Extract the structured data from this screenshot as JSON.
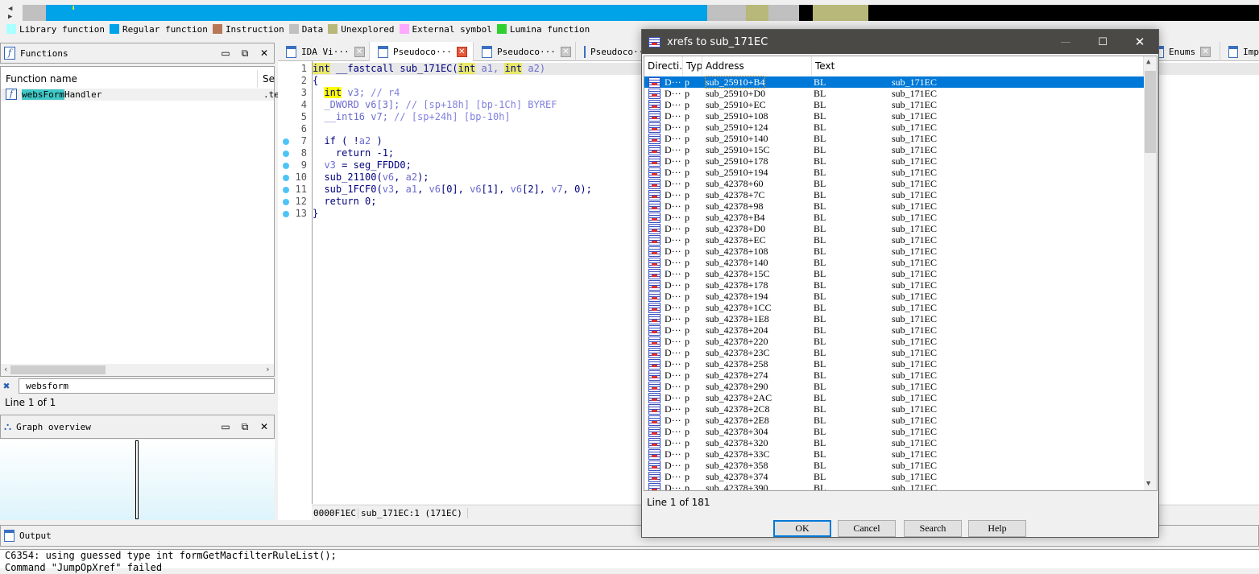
{
  "navbar": {
    "segments": [
      {
        "color": "#c0c0c0",
        "from": 0,
        "to": 1.9
      },
      {
        "color": "#00a2e8",
        "from": 1.9,
        "to": 55.4
      },
      {
        "color": "#c0c0c0",
        "from": 55.4,
        "to": 58.5
      },
      {
        "color": "#b8b87a",
        "from": 58.5,
        "to": 60.3
      },
      {
        "color": "#c0c0c0",
        "from": 60.3,
        "to": 62.8
      },
      {
        "color": "#000000",
        "from": 62.8,
        "to": 63.9
      },
      {
        "color": "#b8b87a",
        "from": 63.9,
        "to": 68.4
      },
      {
        "color": "#000000",
        "from": 68.4,
        "to": 100
      }
    ]
  },
  "legend": [
    {
      "label": "Library function",
      "color": "#aaffff"
    },
    {
      "label": "Regular function",
      "color": "#00a2e8"
    },
    {
      "label": "Instruction",
      "color": "#b87858"
    },
    {
      "label": "Data",
      "color": "#c0c0c0"
    },
    {
      "label": "Unexplored",
      "color": "#b8b87a"
    },
    {
      "label": "External symbol",
      "color": "#ffa8ff"
    },
    {
      "label": "Lumina function",
      "color": "#30d030"
    }
  ],
  "functions": {
    "title": "Functions",
    "col_name": "Function name",
    "col_seg": "Se",
    "rows": [
      {
        "name_match": "websForm",
        "name_rest": "Handler",
        "seg": ".te"
      }
    ],
    "filter": "websform",
    "status": "Line 1 of 1"
  },
  "graph_overview": {
    "title": "Graph overview"
  },
  "tabs": [
    {
      "label": "IDA Vi···"
    },
    {
      "label": "Pseudoco···",
      "active": true
    },
    {
      "label": "Pseudoco···"
    },
    {
      "label": "Pseudoco···"
    },
    {
      "label": "Enums"
    },
    {
      "label": "Imp"
    }
  ],
  "code": {
    "lines": [
      [
        [
          "int",
          "kwl"
        ],
        [
          " __fastcall sub_171EC(",
          "nm"
        ],
        [
          "int",
          "kwl"
        ],
        [
          " a1, ",
          "vr"
        ],
        [
          "int",
          "kwl"
        ],
        [
          " a2)",
          "vr"
        ]
      ],
      [
        [
          "{",
          "nm"
        ]
      ],
      [
        [
          "  ",
          ""
        ],
        [
          "int",
          "kw"
        ],
        [
          " v3; ",
          "vr"
        ],
        [
          "// r4",
          "cm"
        ]
      ],
      [
        [
          "  _DWORD v6[3]; ",
          "vr"
        ],
        [
          "// [sp+18h] [bp-1Ch] BYREF",
          "cm"
        ]
      ],
      [
        [
          "  __int16 v7; ",
          "vr"
        ],
        [
          "// [sp+24h] [bp-10h]",
          "cm"
        ]
      ],
      [
        [
          "",
          ""
        ]
      ],
      [
        [
          "  if ( !",
          "nm"
        ],
        [
          "a2",
          "vr"
        ],
        [
          " )",
          "nm"
        ]
      ],
      [
        [
          "    return -1;",
          "nm"
        ]
      ],
      [
        [
          "  v3",
          "vr"
        ],
        [
          " = seg_FFDD0;",
          "nm"
        ]
      ],
      [
        [
          "  sub_21100(",
          "nm"
        ],
        [
          "v6",
          "vr"
        ],
        [
          ", ",
          "nm"
        ],
        [
          "a2",
          "vr"
        ],
        [
          ");",
          "nm"
        ]
      ],
      [
        [
          "  sub_1FCF0(",
          "nm"
        ],
        [
          "v3",
          "vr"
        ],
        [
          ", ",
          "nm"
        ],
        [
          "a1",
          "vr"
        ],
        [
          ", ",
          "nm"
        ],
        [
          "v6",
          "vr"
        ],
        [
          "[0], ",
          "nm"
        ],
        [
          "v6",
          "vr"
        ],
        [
          "[1], ",
          "nm"
        ],
        [
          "v6",
          "vr"
        ],
        [
          "[2], ",
          "nm"
        ],
        [
          "v7",
          "vr"
        ],
        [
          ", 0);",
          "nm"
        ]
      ],
      [
        [
          "  return 0;",
          "nm"
        ]
      ],
      [
        [
          "}",
          "nm"
        ]
      ]
    ],
    "breakpoint_lines": [
      7,
      8,
      9,
      10,
      11,
      12,
      13
    ],
    "status_addr": "0000F1EC",
    "status_loc": "sub_171EC:1 (171EC)"
  },
  "output": {
    "title": "Output",
    "lines": [
      "C6354: using guessed type int formGetMacfilterRuleList();",
      "Command \"JumpOpXref\" failed"
    ]
  },
  "dialog": {
    "title": "xrefs to sub_171EC",
    "columns": [
      "Directi…",
      "Typ",
      "Address",
      "Text"
    ],
    "rows_dir": "D···",
    "rows_type": "p",
    "rows_text1": "BL",
    "rows_text2": "sub_171EC",
    "addresses": [
      "sub_25910+B4",
      "sub_25910+D0",
      "sub_25910+EC",
      "sub_25910+108",
      "sub_25910+124",
      "sub_25910+140",
      "sub_25910+15C",
      "sub_25910+178",
      "sub_25910+194",
      "sub_42378+60",
      "sub_42378+7C",
      "sub_42378+98",
      "sub_42378+B4",
      "sub_42378+D0",
      "sub_42378+EC",
      "sub_42378+108",
      "sub_42378+140",
      "sub_42378+15C",
      "sub_42378+178",
      "sub_42378+194",
      "sub_42378+1CC",
      "sub_42378+1E8",
      "sub_42378+204",
      "sub_42378+220",
      "sub_42378+23C",
      "sub_42378+258",
      "sub_42378+274",
      "sub_42378+290",
      "sub_42378+2AC",
      "sub_42378+2C8",
      "sub_42378+2E8",
      "sub_42378+304",
      "sub_42378+320",
      "sub_42378+33C",
      "sub_42378+358",
      "sub_42378+374",
      "sub_42378+390"
    ],
    "status": "Line 1 of 181",
    "buttons": {
      "ok": "OK",
      "cancel": "Cancel",
      "search": "Search",
      "help": "Help"
    }
  }
}
